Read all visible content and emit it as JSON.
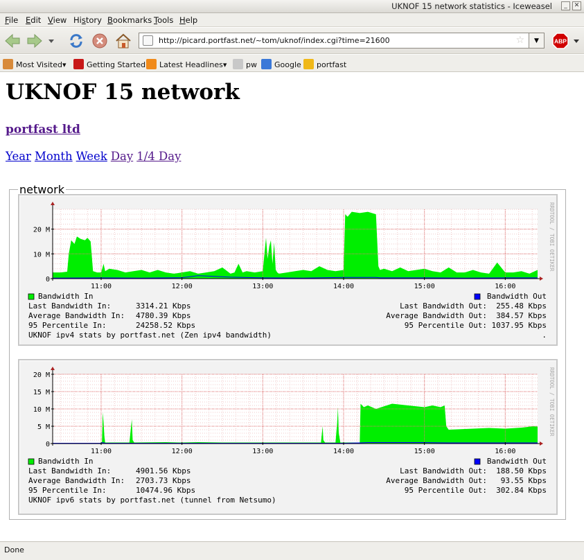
{
  "window": {
    "title": "UKNOF 15 network statistics - Iceweasel"
  },
  "menu": [
    "File",
    "Edit",
    "View",
    "History",
    "Bookmarks",
    "Tools",
    "Help"
  ],
  "menu_access": [
    "F",
    "E",
    "V",
    "s",
    "B",
    "T",
    "H"
  ],
  "navigation": {
    "url": "http://picard.portfast.net/~tom/uknof/index.cgi?time=21600"
  },
  "bookmarks": [
    {
      "label": "Most Visited",
      "dropdown": true,
      "icon": "most-visited-icon"
    },
    {
      "label": "Getting Started",
      "dropdown": false,
      "icon": "getting-started-icon"
    },
    {
      "label": "Latest Headlines",
      "dropdown": true,
      "icon": "rss-feed-icon"
    },
    {
      "label": "pw",
      "dropdown": false,
      "icon": "page-icon"
    },
    {
      "label": "Google",
      "dropdown": false,
      "icon": "google-icon"
    },
    {
      "label": "portfast",
      "dropdown": false,
      "icon": "portfast-icon"
    }
  ],
  "page": {
    "title": "UKNOF 15 network",
    "org_link": "portfast ltd",
    "periods": [
      {
        "label": "Year",
        "visited": false
      },
      {
        "label": "Month",
        "visited": false
      },
      {
        "label": "Week",
        "visited": false
      },
      {
        "label": "Day",
        "visited": true
      },
      {
        "label": "1/4 Day",
        "visited": true
      }
    ],
    "fieldset_legend": "network"
  },
  "colors": {
    "bandwidth_in": "#00ee00",
    "bandwidth_out": "#0000ff",
    "link_visited": "#551a8b",
    "link": "#0000cc"
  },
  "status": {
    "text": "Done"
  },
  "chart_data": [
    {
      "type": "area",
      "watermark": "RRDTOOL / TOBI OETIKER",
      "x_ticks": [
        "11:00",
        "12:00",
        "13:00",
        "14:00",
        "15:00",
        "16:00"
      ],
      "y_ticks": [
        "0",
        "10 M",
        "20 M"
      ],
      "ylim": [
        0,
        28
      ],
      "y_unit": "M",
      "x_range_hours": [
        10.4,
        16.4
      ],
      "legend_in": "Bandwidth In",
      "legend_out": "Bandwidth Out",
      "stats_left": [
        {
          "label": "Last Bandwidth In:",
          "value": "3314.21 Kbps"
        },
        {
          "label": "Average Bandwidth In:",
          "value": "4780.39 Kbps"
        },
        {
          "label": "95 Percentile In:",
          "value": "24258.52 Kbps"
        }
      ],
      "stats_right": [
        {
          "label": "Last Bandwidth Out:",
          "value": "255.48 Kbps"
        },
        {
          "label": "Average Bandwidth Out:",
          "value": "384.57 Kbps"
        },
        {
          "label": "95 Percentile Out:",
          "value": "1037.95 Kbps"
        }
      ],
      "caption": "UKNOF ipv4 stats by portfast.net (Zen ipv4 bandwidth)",
      "caption_right": ".",
      "series": [
        {
          "name": "Bandwidth In",
          "x": [
            10.4,
            10.5,
            10.58,
            10.6,
            10.63,
            10.67,
            10.7,
            10.75,
            10.8,
            10.83,
            10.87,
            10.9,
            10.95,
            11.0,
            11.03,
            11.05,
            11.1,
            11.2,
            11.3,
            11.4,
            11.5,
            11.6,
            11.7,
            11.8,
            11.9,
            12.0,
            12.1,
            12.2,
            12.3,
            12.4,
            12.5,
            12.6,
            12.65,
            12.7,
            12.75,
            12.8,
            12.9,
            13.0,
            13.02,
            13.04,
            13.06,
            13.08,
            13.1,
            13.12,
            13.14,
            13.16,
            13.18,
            13.2,
            13.3,
            13.4,
            13.5,
            13.6,
            13.7,
            13.8,
            13.9,
            14.0,
            14.02,
            14.05,
            14.1,
            14.2,
            14.3,
            14.4,
            14.43,
            14.45,
            14.5,
            14.6,
            14.7,
            14.8,
            14.9,
            15.0,
            15.1,
            15.2,
            15.3,
            15.4,
            15.5,
            15.6,
            15.7,
            15.8,
            15.9,
            16.0,
            16.1,
            16.2,
            16.3,
            16.4
          ],
          "y": [
            2.5,
            2.5,
            2.8,
            10.0,
            15.5,
            14.0,
            17.0,
            16.0,
            15.5,
            16.5,
            15.0,
            3.0,
            2.5,
            2.5,
            6.0,
            3.0,
            4.0,
            3.5,
            2.5,
            3.0,
            3.5,
            2.5,
            3.5,
            2.5,
            2.0,
            2.5,
            3.0,
            2.0,
            2.5,
            3.0,
            4.5,
            2.0,
            2.5,
            6.0,
            2.5,
            3.0,
            2.5,
            3.0,
            10.0,
            16.5,
            8.0,
            13.0,
            15.5,
            6.0,
            14.5,
            3.5,
            2.5,
            2.0,
            2.5,
            3.0,
            3.5,
            3.0,
            5.0,
            3.5,
            3.0,
            3.5,
            26.0,
            25.0,
            27.0,
            26.5,
            27.0,
            26.0,
            5.0,
            3.5,
            4.0,
            3.0,
            4.5,
            3.0,
            3.5,
            4.0,
            3.0,
            2.5,
            4.5,
            2.5,
            2.5,
            3.5,
            2.5,
            2.0,
            6.5,
            2.5,
            2.5,
            3.0,
            2.0,
            3.5
          ]
        },
        {
          "name": "Bandwidth Out",
          "x": [
            10.4,
            11.0,
            11.5,
            12.0,
            12.2,
            12.4,
            12.6,
            13.0,
            13.5,
            14.0,
            14.4,
            14.45,
            15.0,
            15.5,
            16.0,
            16.4
          ],
          "y": [
            0.2,
            0.3,
            0.2,
            0.4,
            1.2,
            0.9,
            0.6,
            0.3,
            0.2,
            0.5,
            0.5,
            0.3,
            0.3,
            0.2,
            0.3,
            0.3
          ]
        }
      ]
    },
    {
      "type": "area",
      "watermark": "RRDTOOL / TOBI OETIKER",
      "x_ticks": [
        "11:00",
        "12:00",
        "13:00",
        "14:00",
        "15:00",
        "16:00"
      ],
      "y_ticks": [
        "0",
        "5 M",
        "10 M",
        "15 M",
        "20 M"
      ],
      "ylim": [
        0,
        20
      ],
      "y_unit": "M",
      "x_range_hours": [
        10.4,
        16.4
      ],
      "legend_in": "Bandwidth In",
      "legend_out": "Bandwidth Out",
      "stats_left": [
        {
          "label": "Last Bandwidth In:",
          "value": "4901.56 Kbps"
        },
        {
          "label": "Average Bandwidth In:",
          "value": "2703.73 Kbps"
        },
        {
          "label": "95 Percentile In:",
          "value": "10474.96 Kbps"
        }
      ],
      "stats_right": [
        {
          "label": "Last Bandwidth Out:",
          "value": "188.50 Kbps"
        },
        {
          "label": "Average Bandwidth Out:",
          "value": "93.55 Kbps"
        },
        {
          "label": "95 Percentile Out:",
          "value": "302.84 Kbps"
        }
      ],
      "caption": "UKNOF ipv6 stats by portfast.net (tunnel from Netsumo)",
      "caption_right": "",
      "series": [
        {
          "name": "Bandwidth In",
          "x": [
            10.4,
            11.0,
            11.01,
            11.02,
            11.03,
            11.04,
            11.05,
            11.35,
            11.37,
            11.38,
            11.39,
            11.41,
            11.8,
            12.0,
            12.2,
            12.5,
            13.0,
            13.5,
            13.72,
            13.74,
            13.75,
            13.77,
            13.9,
            13.92,
            13.93,
            13.94,
            13.96,
            14.2,
            14.21,
            14.25,
            14.3,
            14.4,
            14.6,
            14.8,
            15.0,
            15.1,
            15.2,
            15.25,
            15.27,
            15.3,
            15.5,
            15.8,
            16.0,
            16.2,
            16.35,
            16.4
          ],
          "y": [
            0.2,
            0.2,
            0.5,
            9.0,
            6.0,
            2.0,
            0.3,
            0.3,
            5.0,
            7.0,
            1.0,
            0.3,
            0.4,
            0.3,
            0.4,
            0.3,
            0.3,
            0.3,
            0.3,
            5.0,
            1.0,
            0.3,
            0.3,
            6.0,
            10.5,
            3.0,
            0.3,
            0.3,
            11.5,
            10.5,
            11.0,
            10.0,
            11.5,
            11.0,
            10.5,
            11.0,
            10.5,
            11.0,
            5.0,
            4.0,
            4.2,
            4.5,
            4.3,
            4.6,
            5.0,
            4.9
          ]
        },
        {
          "name": "Bandwidth Out",
          "x": [
            10.4,
            11.0,
            11.02,
            11.05,
            12.0,
            13.0,
            14.0,
            14.2,
            14.3,
            15.0,
            15.3,
            16.0,
            16.4
          ],
          "y": [
            0.1,
            0.1,
            0.3,
            0.1,
            0.1,
            0.1,
            0.1,
            0.2,
            0.3,
            0.3,
            0.2,
            0.2,
            0.2
          ]
        }
      ]
    }
  ]
}
